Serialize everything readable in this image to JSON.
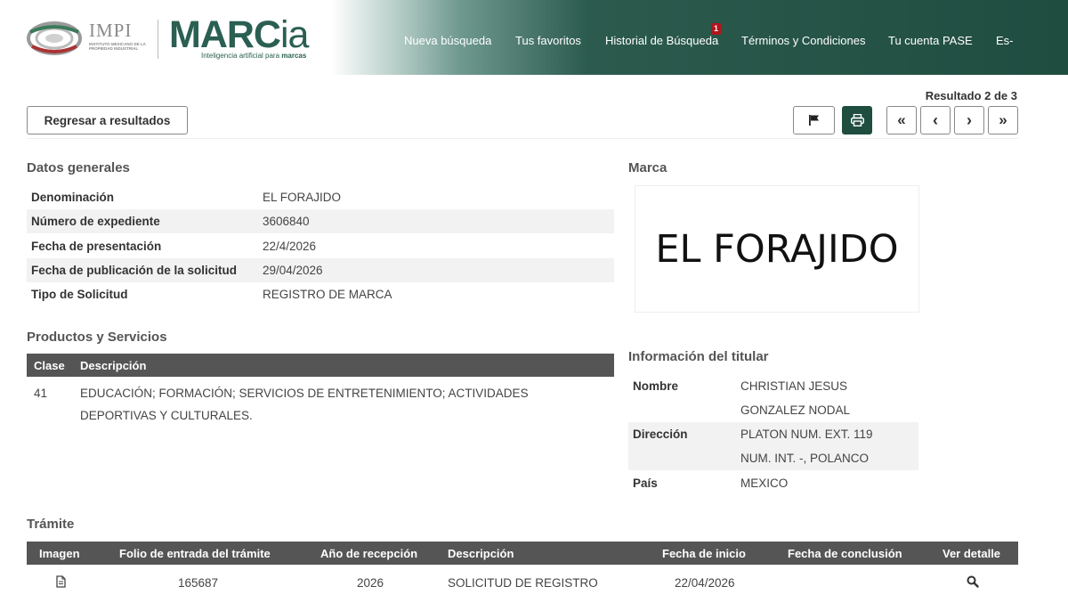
{
  "header": {
    "impi_word": "IMPI",
    "impi_sub": "Instituto Mexicano de la Propiedad Industrial",
    "marcia_main": "MARC",
    "marcia_ia": "ia",
    "marcia_sub_prefix": "Inteligencia artificial para ",
    "marcia_sub_bold": "marcas",
    "nav": [
      "Nueva búsqueda",
      "Tus favoritos",
      "Historial de Búsqueda",
      "Términos y Condiciones",
      "Tu cuenta PASE",
      "Es-"
    ],
    "history_badge": "1",
    "colors": {
      "brand_dark": "#1f4d40",
      "brand": "#2a5f52",
      "badge": "#b4141c"
    }
  },
  "toolbar": {
    "result_count": "Resultado 2 de 3",
    "back_label": "Regresar a resultados",
    "icons": [
      "flag-icon",
      "print-icon",
      "first-icon",
      "prev-icon",
      "next-icon",
      "last-icon"
    ],
    "first_glyph": "«",
    "prev_glyph": "‹",
    "next_glyph": "›",
    "last_glyph": "»"
  },
  "datos_generales": {
    "title": "Datos generales",
    "rows": [
      {
        "key": "Denominación",
        "value": "EL FORAJIDO"
      },
      {
        "key": "Número de expediente",
        "value": "3606840"
      },
      {
        "key": "Fecha de presentación",
        "value": "22/4/2026"
      },
      {
        "key": "Fecha de publicación de la solicitud",
        "value": "29/04/2026"
      },
      {
        "key": "Tipo de Solicitud",
        "value": "REGISTRO DE MARCA"
      }
    ]
  },
  "productos": {
    "title": "Productos y Servicios",
    "headers": [
      "Clase",
      "Descripción"
    ],
    "rows": [
      {
        "clase": "41",
        "descripcion_1": "EDUCACIÓN; FORMACIÓN; SERVICIOS DE ENTRETENIMIENTO; ACTIVIDADES",
        "descripcion_2": "DEPORTIVAS Y CULTURALES."
      }
    ]
  },
  "marca": {
    "title": "Marca",
    "text": "EL FORAJIDO"
  },
  "titular": {
    "title": "Información del titular",
    "rows": [
      {
        "key": "Nombre",
        "line1": "CHRISTIAN JESUS",
        "line2": "GONZALEZ NODAL"
      },
      {
        "key": "Dirección",
        "line1": "PLATON NUM. EXT. 119",
        "line2": "NUM. INT. -, POLANCO"
      },
      {
        "key": "País",
        "line1": "MEXICO"
      }
    ]
  },
  "tramite": {
    "title": "Trámite",
    "headers": [
      "Imagen",
      "Folio de entrada del trámite",
      "Año de recepción",
      "Descripción",
      "Fecha de inicio",
      "Fecha de conclusión",
      "Ver detalle"
    ],
    "rows": [
      {
        "imagen_icon": "document-icon",
        "folio": "165687",
        "anio": "2026",
        "descripcion": "SOLICITUD DE REGISTRO",
        "fecha_inicio": "22/04/2026",
        "fecha_conclusion": "",
        "detalle_icon": "search-icon"
      }
    ]
  }
}
